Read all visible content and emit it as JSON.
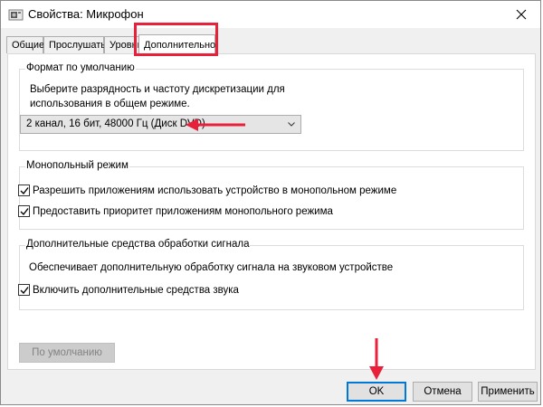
{
  "window": {
    "title": "Свойства: Микрофон",
    "icons": {
      "app": "speaker-icon",
      "close": "close-icon"
    }
  },
  "tabs": [
    {
      "label": "Общие",
      "active": false
    },
    {
      "label": "Прослушать",
      "active": false
    },
    {
      "label": "Уровни",
      "active": false
    },
    {
      "label": "Дополнительно",
      "active": true
    }
  ],
  "default_format": {
    "title": "Формат по умолчанию",
    "description_line1": "Выберите разрядность и частоту дискретизации для",
    "description_line2": "использования в общем режиме.",
    "selected": "2 канал, 16 бит, 48000 Гц (Диск DVD)",
    "arrow_icon": "chevron-down-icon"
  },
  "exclusive_mode": {
    "title": "Монопольный режим",
    "options": [
      {
        "label": "Разрешить приложениям использовать устройство в монопольном режиме",
        "checked": true
      },
      {
        "label": "Предоставить приоритет приложениям монопольного режима",
        "checked": true
      }
    ]
  },
  "signal_enhancements": {
    "title": "Дополнительные средства обработки сигнала",
    "description": "Обеспечивает дополнительную обработку сигнала на звуковом устройстве",
    "options": [
      {
        "label": "Включить дополнительные средства звука",
        "checked": true
      }
    ]
  },
  "buttons": {
    "restore_defaults": "По умолчанию",
    "ok": "OK",
    "cancel": "Отмена",
    "apply": "Применить"
  },
  "annotation_color": "#e8203a"
}
